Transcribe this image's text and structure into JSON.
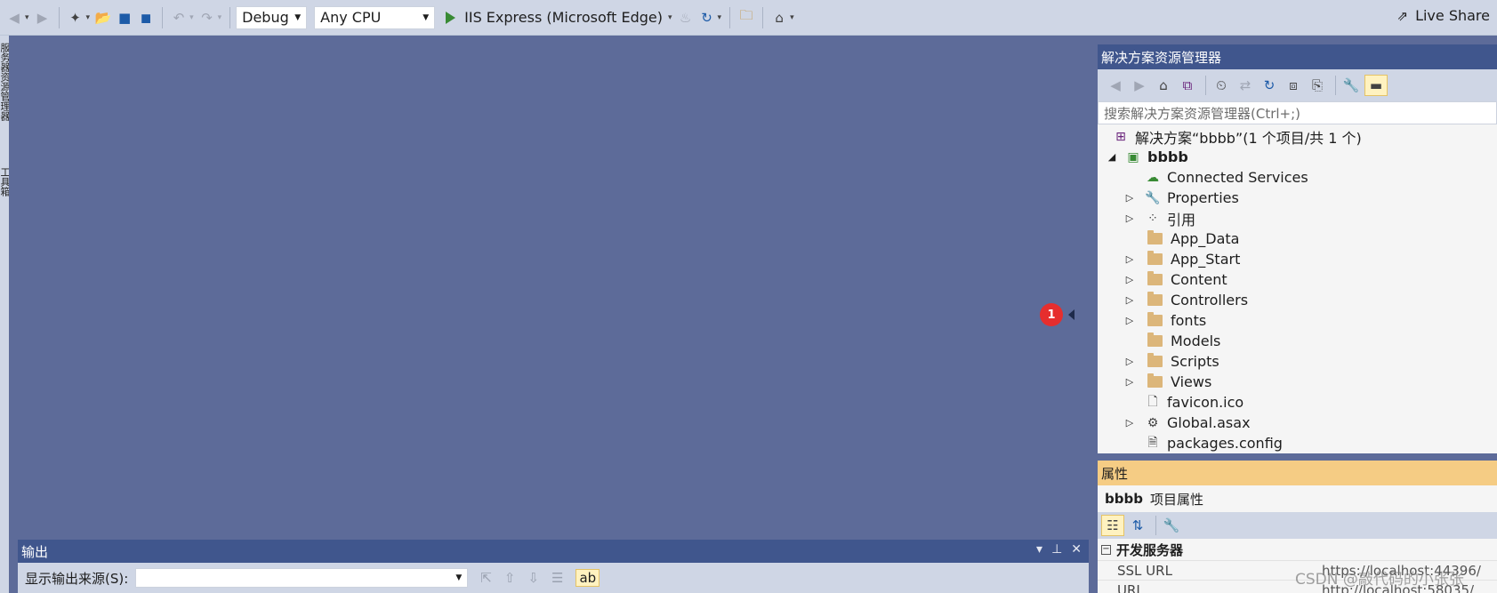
{
  "toolbar": {
    "config": "Debug",
    "platform": "Any CPU",
    "run_target": "IIS Express (Microsoft Edge)",
    "live_share": "Live Share"
  },
  "side_tabs": [
    "服务器资源管理器",
    "工具箱"
  ],
  "notification": {
    "count": "1"
  },
  "output": {
    "title": "输出",
    "source_label": "显示输出来源(S):",
    "source_value": ""
  },
  "solution_explorer": {
    "title": "解决方案资源管理器",
    "search_placeholder": "搜索解决方案资源管理器(Ctrl+;)",
    "solution": "解决方案“bbbb”(1 个项目/共 1 个)",
    "project": "bbbb",
    "items": [
      {
        "label": "Connected Services",
        "icon": "cloud-icon",
        "expandable": false
      },
      {
        "label": "Properties",
        "icon": "wrench-icon",
        "expandable": true
      },
      {
        "label": "引用",
        "icon": "references-icon",
        "expandable": true
      },
      {
        "label": "App_Data",
        "icon": "folder-icon",
        "expandable": false
      },
      {
        "label": "App_Start",
        "icon": "folder-icon",
        "expandable": true
      },
      {
        "label": "Content",
        "icon": "folder-icon",
        "expandable": true
      },
      {
        "label": "Controllers",
        "icon": "folder-icon",
        "expandable": true
      },
      {
        "label": "fonts",
        "icon": "folder-icon",
        "expandable": true
      },
      {
        "label": "Models",
        "icon": "folder-icon",
        "expandable": false
      },
      {
        "label": "Scripts",
        "icon": "folder-icon",
        "expandable": true
      },
      {
        "label": "Views",
        "icon": "folder-icon",
        "expandable": true
      },
      {
        "label": "favicon.ico",
        "icon": "file-icon",
        "expandable": false
      },
      {
        "label": "Global.asax",
        "icon": "gear-file-icon",
        "expandable": true
      },
      {
        "label": "packages.config",
        "icon": "config-file-icon",
        "expandable": false
      }
    ]
  },
  "properties": {
    "title": "属性",
    "object_name": "bbbb",
    "object_type": "项目属性",
    "category": "开发服务器",
    "rows": [
      {
        "name": "SSL URL",
        "value": "https://localhost:44396/"
      },
      {
        "name": "URL",
        "value": "http://localhost:58035/"
      }
    ]
  },
  "watermark": "CSDN @敲代码的小张张"
}
